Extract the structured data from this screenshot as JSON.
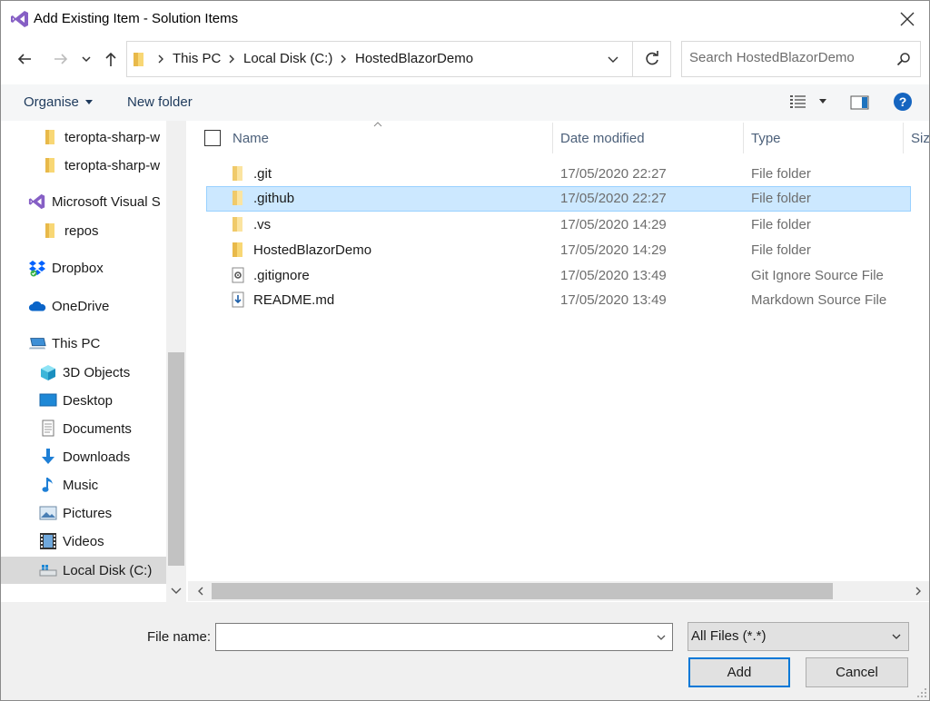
{
  "window": {
    "title": "Add Existing Item - Solution Items"
  },
  "address": {
    "breadcrumbs": [
      "This PC",
      "Local Disk (C:)",
      "HostedBlazorDemo"
    ]
  },
  "search": {
    "placeholder": "Search HostedBlazorDemo"
  },
  "toolbar": {
    "organise": "Organise",
    "new_folder": "New folder"
  },
  "nav": {
    "items": [
      {
        "label": "teropta-sharp-w",
        "icon": "folder-icon"
      },
      {
        "label": "teropta-sharp-w",
        "icon": "folder-icon"
      },
      {
        "label": "Microsoft Visual S",
        "icon": "visual-studio-icon"
      },
      {
        "label": "repos",
        "icon": "folder-icon"
      },
      {
        "label": "Dropbox",
        "icon": "dropbox-icon"
      },
      {
        "label": "OneDrive",
        "icon": "onedrive-icon"
      },
      {
        "label": "This PC",
        "icon": "computer-icon"
      },
      {
        "label": "3D Objects",
        "icon": "cube-icon"
      },
      {
        "label": "Desktop",
        "icon": "desktop-icon"
      },
      {
        "label": "Documents",
        "icon": "document-icon"
      },
      {
        "label": "Downloads",
        "icon": "download-icon"
      },
      {
        "label": "Music",
        "icon": "music-icon"
      },
      {
        "label": "Pictures",
        "icon": "pictures-icon"
      },
      {
        "label": "Videos",
        "icon": "film-icon"
      },
      {
        "label": "Local Disk (C:)",
        "icon": "drive-icon"
      }
    ]
  },
  "columns": {
    "name": "Name",
    "date": "Date modified",
    "type": "Type",
    "size": "Size"
  },
  "files": [
    {
      "name": ".git",
      "date": "17/05/2020 22:27",
      "type": "File folder",
      "icon": "folder-icon"
    },
    {
      "name": ".github",
      "date": "17/05/2020 22:27",
      "type": "File folder",
      "icon": "folder-icon",
      "selected": true
    },
    {
      "name": ".vs",
      "date": "17/05/2020 14:29",
      "type": "File folder",
      "icon": "folder-icon"
    },
    {
      "name": "HostedBlazorDemo",
      "date": "17/05/2020 14:29",
      "type": "File folder",
      "icon": "folder-icon"
    },
    {
      "name": ".gitignore",
      "date": "17/05/2020 13:49",
      "type": "Git Ignore Source File",
      "icon": "settings-file-icon"
    },
    {
      "name": "README.md",
      "date": "17/05/2020 13:49",
      "type": "Markdown Source File",
      "icon": "markdown-file-icon"
    }
  ],
  "bottom": {
    "file_name_label": "File name:",
    "file_name_value": "",
    "filter": "All Files (*.*)",
    "add": "Add",
    "cancel": "Cancel"
  },
  "colors": {
    "selection_bg": "#cce8ff",
    "selection_border": "#99d1ff",
    "accent": "#0078d7",
    "link_text": "#1e3a5c"
  }
}
